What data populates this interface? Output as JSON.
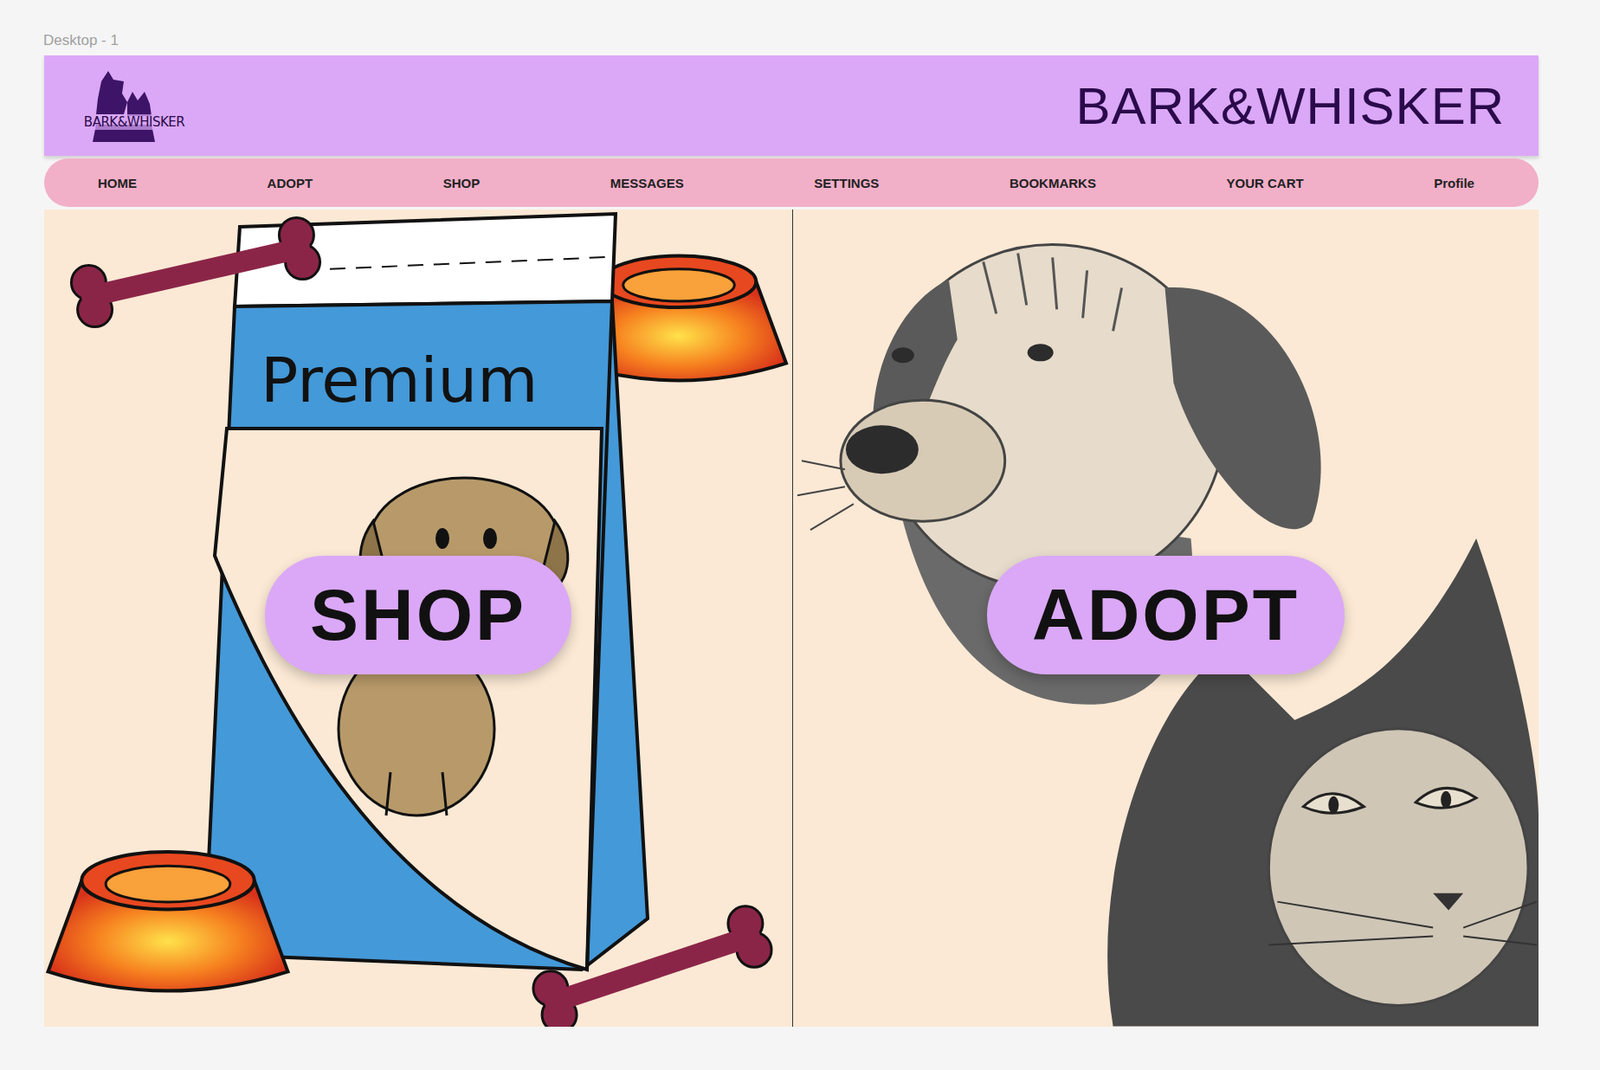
{
  "canvas": {
    "frame_label": "Desktop - 1"
  },
  "header": {
    "logo_text": "BARK&WHISKER",
    "title": "BARK&WHISKER"
  },
  "nav": {
    "items": [
      "HOME",
      "ADOPT",
      "SHOP",
      "MESSAGES",
      "SETTINGS",
      "BOOKMARKS",
      "YOUR CART",
      "Profile"
    ]
  },
  "panels": [
    {
      "kind": "shop",
      "button": "SHOP",
      "bag_label": "Premium"
    },
    {
      "kind": "adopt",
      "button": "ADOPT"
    }
  ]
}
